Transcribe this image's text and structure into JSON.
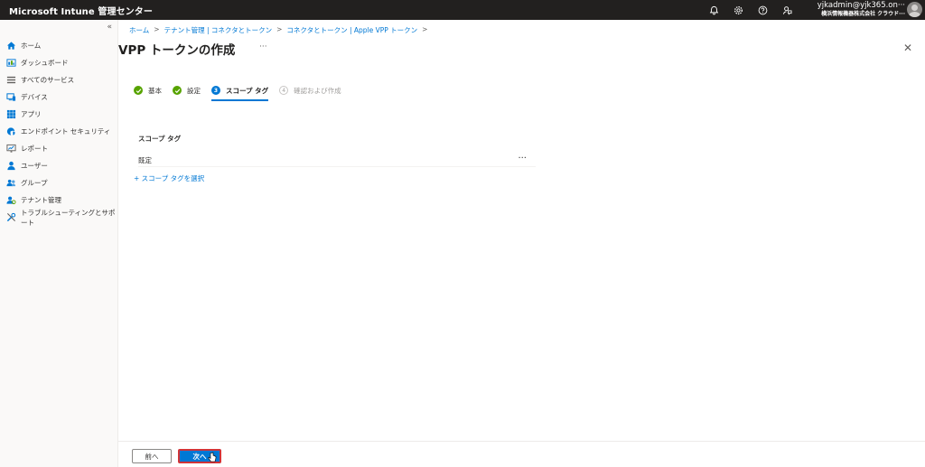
{
  "header": {
    "app_title": "Microsoft Intune 管理センター",
    "user_name": "yjkadmin@yjk365.on···",
    "user_org": "横浜情報機器株式会社 クラウド···"
  },
  "sidebar": {
    "collapse_glyph": "«",
    "items": [
      {
        "label": "ホーム",
        "icon": "home-icon"
      },
      {
        "label": "ダッシュボード",
        "icon": "dashboard-icon"
      },
      {
        "label": "すべてのサービス",
        "icon": "all-services-icon"
      },
      {
        "label": "デバイス",
        "icon": "devices-icon"
      },
      {
        "label": "アプリ",
        "icon": "apps-icon"
      },
      {
        "label": "エンドポイント セキュリティ",
        "icon": "endpoint-security-icon"
      },
      {
        "label": "レポート",
        "icon": "reports-icon"
      },
      {
        "label": "ユーザー",
        "icon": "users-icon"
      },
      {
        "label": "グループ",
        "icon": "groups-icon"
      },
      {
        "label": "テナント管理",
        "icon": "tenant-admin-icon"
      },
      {
        "label": "トラブルシューティングとサポート",
        "icon": "troubleshoot-icon"
      }
    ]
  },
  "breadcrumb": [
    "ホーム",
    "テナント管理 | コネクタとトークン",
    "コネクタとトークン | Apple VPP トークン"
  ],
  "page": {
    "title": "VPP トークンの作成",
    "more_glyph": "···",
    "close_glyph": "✕"
  },
  "steps": [
    {
      "label": "基本",
      "state": "done",
      "number": ""
    },
    {
      "label": "設定",
      "state": "done",
      "number": ""
    },
    {
      "label": "スコープ タグ",
      "state": "active",
      "number": "3"
    },
    {
      "label": "確認および作成",
      "state": "future",
      "number": "4"
    }
  ],
  "scope": {
    "section_label": "スコープ タグ",
    "tag_value": "既定",
    "tag_more": "···",
    "add_link": "+ スコープ タグを選択"
  },
  "footer": {
    "prev_label": "前へ",
    "next_label": "次へ"
  },
  "colors": {
    "accent": "#0078d4",
    "done": "#57a300",
    "highlight": "#d13438"
  }
}
